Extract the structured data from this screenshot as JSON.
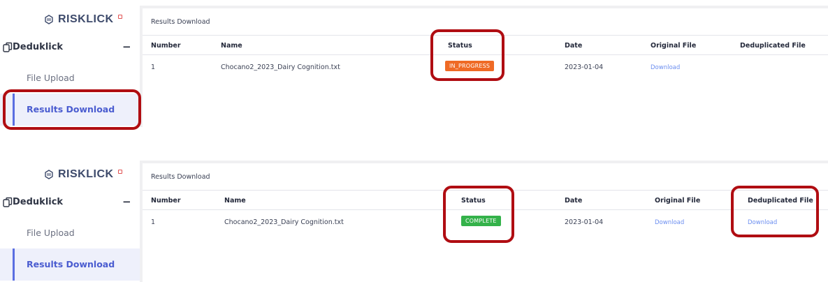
{
  "brand": {
    "name": "RISKLICK",
    "accent_color": "#e05252"
  },
  "colors": {
    "highlight": "#b00d12",
    "in_progress": "#ef6a25",
    "complete": "#34b24a",
    "link": "#6b8ef0",
    "nav_active": "#4a5cd0"
  },
  "panels": [
    {
      "sidebar": {
        "group_label": "Deduklick",
        "collapse_symbol": "−",
        "items": [
          {
            "label": "File Upload",
            "active": false
          },
          {
            "label": "Results Download",
            "active": true
          }
        ]
      },
      "card_title": "Results Download",
      "columns": [
        "Number",
        "Name",
        "Status",
        "Date",
        "Original File",
        "Deduplicated File"
      ],
      "rows": [
        {
          "number": "1",
          "name": "Chocano2_2023_Dairy Cognition.txt",
          "status": "IN_PROGRESS",
          "date": "2023-01-04",
          "original_file": "Download",
          "deduplicated_file": ""
        }
      ]
    },
    {
      "sidebar": {
        "group_label": "Deduklick",
        "collapse_symbol": "−",
        "items": [
          {
            "label": "File Upload",
            "active": false
          },
          {
            "label": "Results Download",
            "active": true
          }
        ]
      },
      "card_title": "Results Download",
      "columns": [
        "Number",
        "Name",
        "Status",
        "Date",
        "Original File",
        "Deduplicated File"
      ],
      "rows": [
        {
          "number": "1",
          "name": "Chocano2_2023_Dairy Cognition.txt",
          "status": "COMPLETE",
          "date": "2023-01-04",
          "original_file": "Download",
          "deduplicated_file": "Download"
        }
      ]
    }
  ]
}
